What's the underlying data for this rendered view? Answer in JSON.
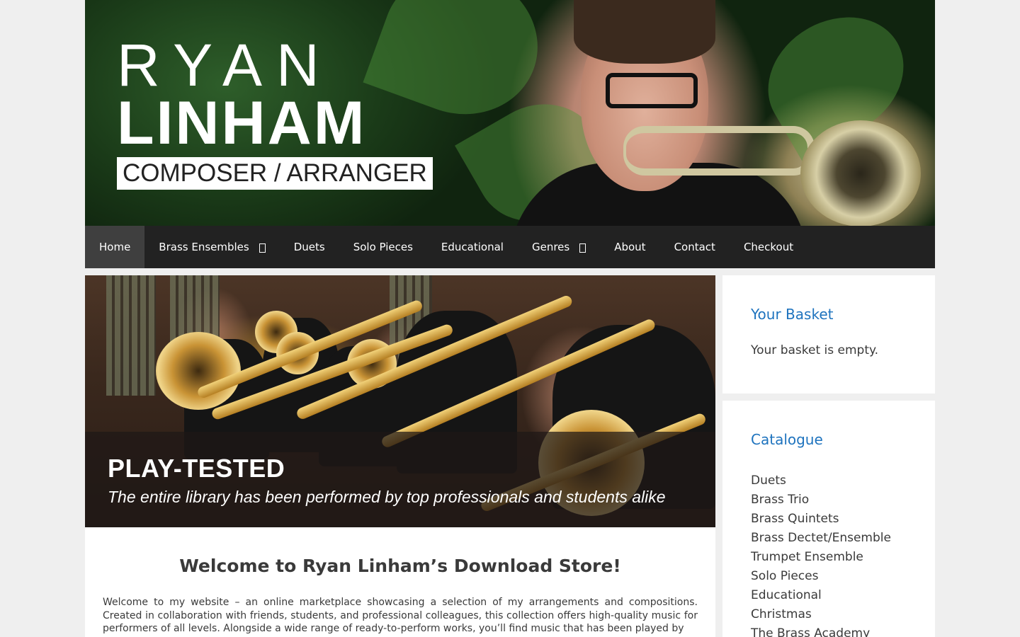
{
  "header": {
    "logo_line1": "RYAN",
    "logo_line2": "LINHAM",
    "logo_tagline": "COMPOSER / ARRANGER"
  },
  "nav": {
    "items": [
      {
        "label": "Home",
        "active": true
      },
      {
        "label": "Brass Ensembles",
        "has_dropdown": true
      },
      {
        "label": "Duets"
      },
      {
        "label": "Solo Pieces"
      },
      {
        "label": "Educational"
      },
      {
        "label": "Genres",
        "has_dropdown": true
      },
      {
        "label": "About"
      },
      {
        "label": "Contact"
      },
      {
        "label": "Checkout"
      }
    ]
  },
  "slide": {
    "title": "PLAY-TESTED",
    "subtitle": "The entire library has been performed by top professionals and students alike"
  },
  "main": {
    "heading": "Welcome to Ryan Linham’s Download Store!",
    "intro": "Welcome to my website – an online marketplace showcasing a selection of my arrangements and compositions. Created in collaboration with friends, students, and professional colleagues, this collection offers high-quality music for performers of all levels. Alongside a wide range of ready-to-perform works, you’ll find music that has been played by"
  },
  "sidebar": {
    "basket": {
      "title": "Your Basket",
      "empty_text": "Your basket is empty."
    },
    "catalogue": {
      "title": "Catalogue",
      "items": [
        "Duets",
        "Brass Trio",
        "Brass Quintets",
        "Brass Dectet/Ensemble",
        "Trumpet Ensemble",
        "Solo Pieces",
        "Educational",
        "Christmas",
        "The Brass Academy"
      ]
    }
  },
  "colors": {
    "nav_bg": "#222222",
    "nav_active_bg": "#3f3f3f",
    "link": "#1e73be",
    "page_bg": "#efefef"
  }
}
